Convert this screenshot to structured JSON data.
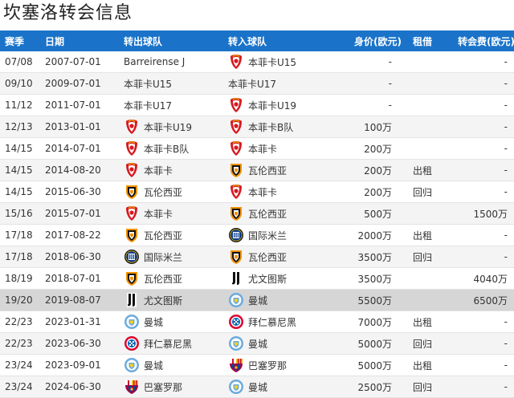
{
  "page": {
    "title": "坎塞洛转会信息"
  },
  "columns": {
    "season": "赛季",
    "date": "日期",
    "from": "转出球队",
    "to": "转入球队",
    "value": "身价(欧元)",
    "loan": "租借",
    "fee": "转会费(欧元)"
  },
  "rows": [
    {
      "season": "07/08",
      "date": "2007-07-01",
      "from": "Barreirense J",
      "from_icon": "none",
      "to": "本菲卡U15",
      "to_icon": "benfica-icon",
      "value": "-",
      "loan": "",
      "fee": "-"
    },
    {
      "season": "09/10",
      "date": "2009-07-01",
      "from": "本菲卡U15",
      "from_icon": "none",
      "to": "本菲卡U17",
      "to_icon": "none",
      "value": "-",
      "loan": "",
      "fee": "-"
    },
    {
      "season": "11/12",
      "date": "2011-07-01",
      "from": "本菲卡U17",
      "from_icon": "none",
      "to": "本菲卡U19",
      "to_icon": "benfica-icon",
      "value": "-",
      "loan": "",
      "fee": "-"
    },
    {
      "season": "12/13",
      "date": "2013-01-01",
      "from": "本菲卡U19",
      "from_icon": "benfica-icon",
      "to": "本菲卡B队",
      "to_icon": "benfica-icon",
      "value": "100万",
      "loan": "",
      "fee": "-"
    },
    {
      "season": "14/15",
      "date": "2014-07-01",
      "from": "本菲卡B队",
      "from_icon": "benfica-icon",
      "to": "本菲卡",
      "to_icon": "benfica-icon",
      "value": "200万",
      "loan": "",
      "fee": "-"
    },
    {
      "season": "14/15",
      "date": "2014-08-20",
      "from": "本菲卡",
      "from_icon": "benfica-icon",
      "to": "瓦伦西亚",
      "to_icon": "valencia-icon",
      "value": "200万",
      "loan": "出租",
      "fee": "-"
    },
    {
      "season": "14/15",
      "date": "2015-06-30",
      "from": "瓦伦西亚",
      "from_icon": "valencia-icon",
      "to": "本菲卡",
      "to_icon": "benfica-icon",
      "value": "200万",
      "loan": "回归",
      "fee": "-"
    },
    {
      "season": "15/16",
      "date": "2015-07-01",
      "from": "本菲卡",
      "from_icon": "benfica-icon",
      "to": "瓦伦西亚",
      "to_icon": "valencia-icon",
      "value": "500万",
      "loan": "",
      "fee": "1500万"
    },
    {
      "season": "17/18",
      "date": "2017-08-22",
      "from": "瓦伦西亚",
      "from_icon": "valencia-icon",
      "to": "国际米兰",
      "to_icon": "inter-icon",
      "value": "2000万",
      "loan": "出租",
      "fee": "-"
    },
    {
      "season": "17/18",
      "date": "2018-06-30",
      "from": "国际米兰",
      "from_icon": "inter-icon",
      "to": "瓦伦西亚",
      "to_icon": "valencia-icon",
      "value": "3500万",
      "loan": "回归",
      "fee": "-"
    },
    {
      "season": "18/19",
      "date": "2018-07-01",
      "from": "瓦伦西亚",
      "from_icon": "valencia-icon",
      "to": "尤文图斯",
      "to_icon": "juventus-icon",
      "value": "3500万",
      "loan": "",
      "fee": "4040万"
    },
    {
      "season": "19/20",
      "date": "2019-08-07",
      "from": "尤文图斯",
      "from_icon": "juventus-icon",
      "to": "曼城",
      "to_icon": "mancity-icon",
      "value": "5500万",
      "loan": "",
      "fee": "6500万",
      "highlight": true
    },
    {
      "season": "22/23",
      "date": "2023-01-31",
      "from": "曼城",
      "from_icon": "mancity-icon",
      "to": "拜仁慕尼黑",
      "to_icon": "bayern-icon",
      "value": "7000万",
      "loan": "出租",
      "fee": "-"
    },
    {
      "season": "22/23",
      "date": "2023-06-30",
      "from": "拜仁慕尼黑",
      "from_icon": "bayern-icon",
      "to": "曼城",
      "to_icon": "mancity-icon",
      "value": "5000万",
      "loan": "回归",
      "fee": "-"
    },
    {
      "season": "23/24",
      "date": "2023-09-01",
      "from": "曼城",
      "from_icon": "mancity-icon",
      "to": "巴塞罗那",
      "to_icon": "barcelona-icon",
      "value": "5000万",
      "loan": "出租",
      "fee": "-"
    },
    {
      "season": "23/24",
      "date": "2024-06-30",
      "from": "巴塞罗那",
      "from_icon": "barcelona-icon",
      "to": "曼城",
      "to_icon": "mancity-icon",
      "value": "2500万",
      "loan": "回归",
      "fee": "-"
    }
  ],
  "colors": {
    "header_bg": "#1a73c9",
    "header_text": "#ffffff",
    "highlight_row": "#d6d6d6"
  }
}
